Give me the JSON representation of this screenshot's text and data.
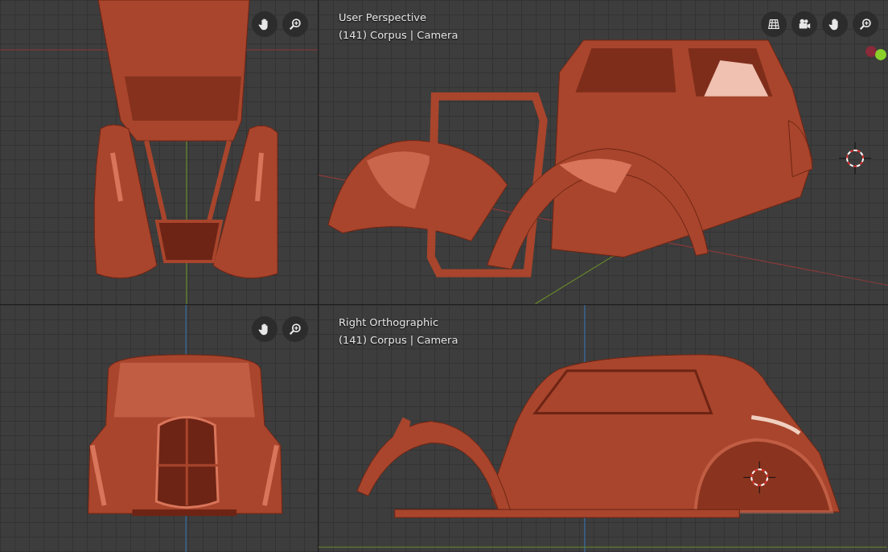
{
  "viewports": [
    {
      "kind": "top"
    },
    {
      "kind": "perspective",
      "title": "User Perspective",
      "subtitle": "(141) Corpus | Camera"
    },
    {
      "kind": "front"
    },
    {
      "kind": "side",
      "title": "Right Orthographic",
      "subtitle": "(141) Corpus | Camera"
    }
  ]
}
